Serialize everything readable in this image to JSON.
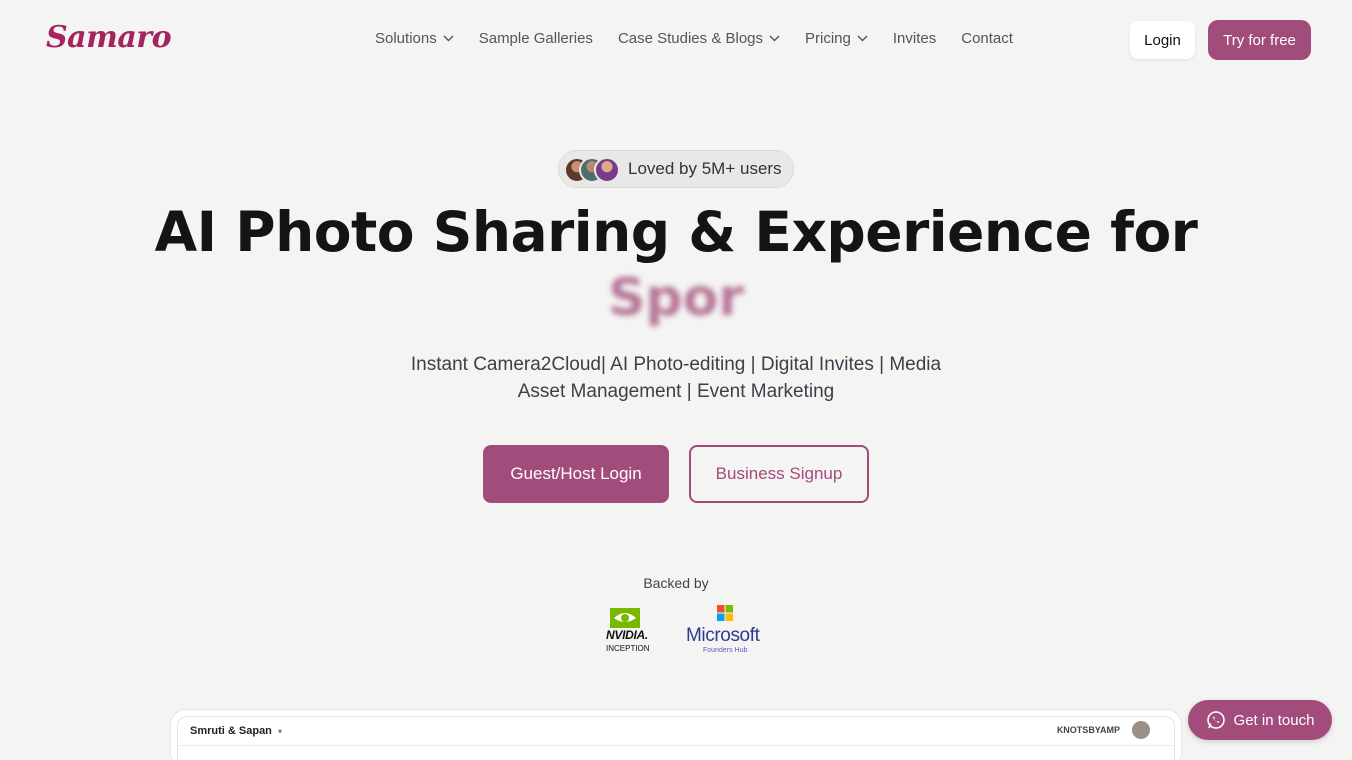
{
  "nav": {
    "logo": "Samaro",
    "items": [
      {
        "label": "Solutions",
        "has_dropdown": true
      },
      {
        "label": "Sample Galleries",
        "has_dropdown": false
      },
      {
        "label": "Case Studies & Blogs",
        "has_dropdown": true
      },
      {
        "label": "Pricing",
        "has_dropdown": true
      },
      {
        "label": "Invites",
        "has_dropdown": false
      },
      {
        "label": "Contact",
        "has_dropdown": false
      }
    ],
    "login_label": "Login",
    "try_label": "Try for free"
  },
  "hero": {
    "badge": "Loved by 5M+ users",
    "headline": "AI Photo Sharing & Experience for",
    "rotating_word": "Spor",
    "subtitle": "Instant Camera2Cloud| AI Photo-editing | Digital Invites | Media Asset Management | Event Marketing",
    "primary_button": "Guest/Host Login",
    "secondary_button": "Business Signup"
  },
  "backed": {
    "label": "Backed by",
    "nvidia_name": "NVIDIA.",
    "nvidia_sub": "INCEPTION",
    "microsoft_name": "Microsoft",
    "microsoft_sub": "Founders Hub"
  },
  "preview": {
    "title": "Smruti & Sapan",
    "brand": "KNOTSBYAMP"
  },
  "floating": {
    "get_in_touch": "Get in touch"
  },
  "colors": {
    "brand": "#a24c7b",
    "logo": "#a3245f",
    "background": "#f4f4f3"
  }
}
